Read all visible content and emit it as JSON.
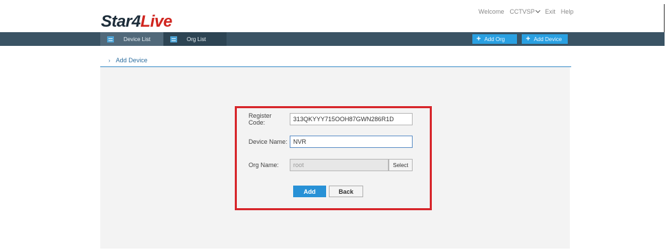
{
  "header": {
    "logo_part1": "Star4",
    "logo_part2": "Live",
    "welcome": "Welcome",
    "user": "CCTVSP",
    "exit": "Exit",
    "help": "Help"
  },
  "nav": {
    "tabs": [
      {
        "label": "Device List",
        "active": true
      },
      {
        "label": "Org List",
        "active": false
      }
    ],
    "add_org": "Add Org",
    "add_device": "Add Device"
  },
  "breadcrumb": {
    "label": "Add Device"
  },
  "form": {
    "register_code": {
      "label": "Register Code:",
      "value": "313QKYYY715OOH87GWN286R1D"
    },
    "device_name": {
      "label": "Device Name:",
      "value": "NVR"
    },
    "org_name": {
      "label": "Org Name:",
      "value": "root",
      "select_label": "Select"
    },
    "add_label": "Add",
    "back_label": "Back"
  },
  "colors": {
    "navbar": "#3a5364",
    "accent": "#29a0e2",
    "highlight_border": "#d7262b",
    "brand_dark": "#1d2d3a",
    "brand_red": "#d0251f"
  },
  "icons": [
    "list-icon",
    "plus-icon",
    "chevron-down-icon",
    "breadcrumb-arrow-icon"
  ]
}
